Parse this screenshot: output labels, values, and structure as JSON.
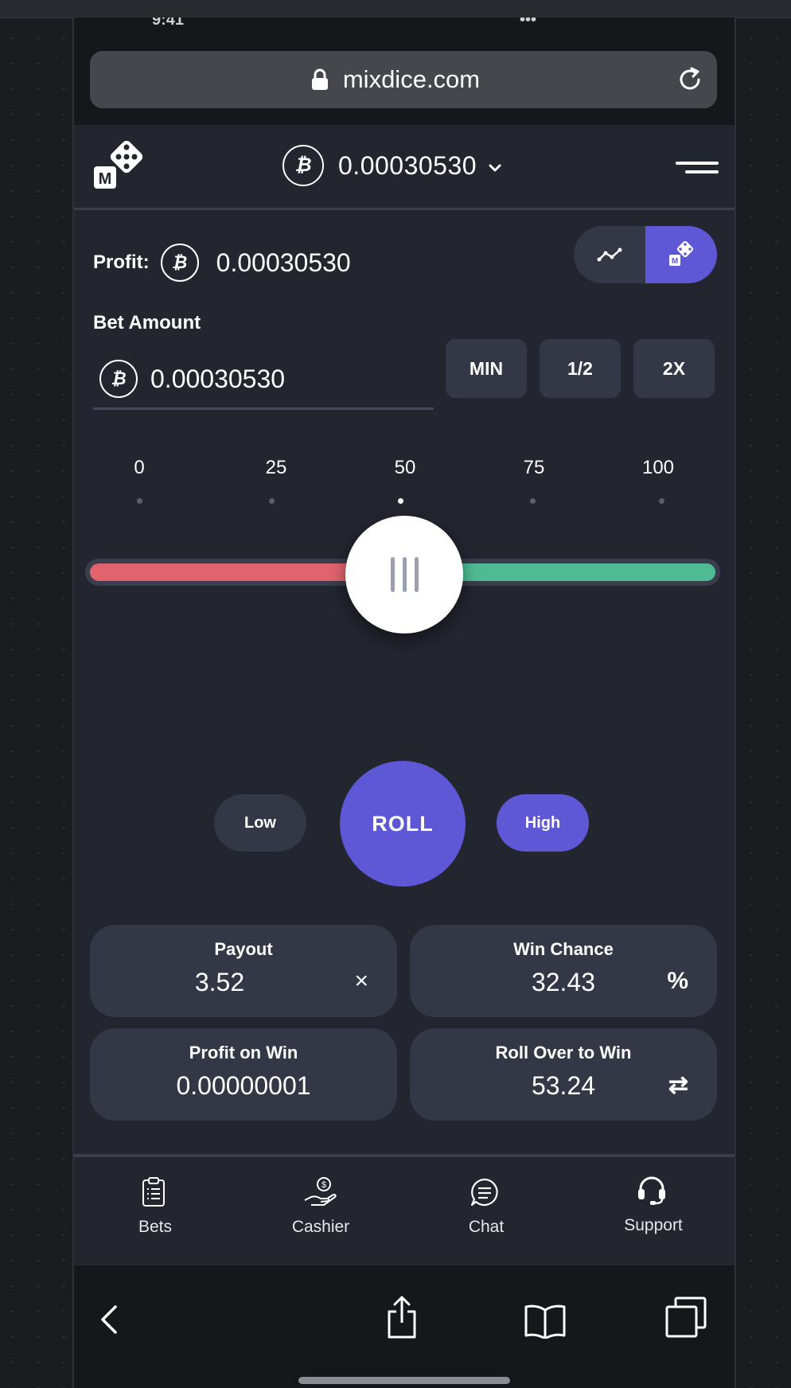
{
  "browser": {
    "status_time_fragment": "9:41",
    "status_right_fragment": "•••",
    "url": "mixdice.com"
  },
  "header": {
    "balance": "0.00030530"
  },
  "profit": {
    "label": "Profit:",
    "value": "0.00030530"
  },
  "bet": {
    "label": "Bet Amount",
    "value": "0.00030530",
    "buttons": [
      "MIN",
      "1/2",
      "2X"
    ]
  },
  "slider": {
    "scale": [
      "0",
      "25",
      "50",
      "75",
      "100"
    ],
    "value": 53.24
  },
  "actions": {
    "low": "Low",
    "roll": "ROLL",
    "high": "High"
  },
  "stats": {
    "payout": {
      "title": "Payout",
      "value": "3.52",
      "symbol": "×"
    },
    "win_chance": {
      "title": "Win Chance",
      "value": "32.43",
      "symbol": "%"
    },
    "profit_on_win": {
      "title": "Profit on Win",
      "value": "0.00000001"
    },
    "roll_over": {
      "title": "Roll Over to Win",
      "value": "53.24",
      "symbol": "⇄"
    }
  },
  "nav": {
    "bets": "Bets",
    "cashier": "Cashier",
    "chat": "Chat",
    "support": "Support"
  },
  "colors": {
    "accent": "#5e57d6",
    "low_zone": "#e0636d",
    "high_zone": "#4fbb94",
    "panel": "#343746",
    "background": "#23252f"
  }
}
